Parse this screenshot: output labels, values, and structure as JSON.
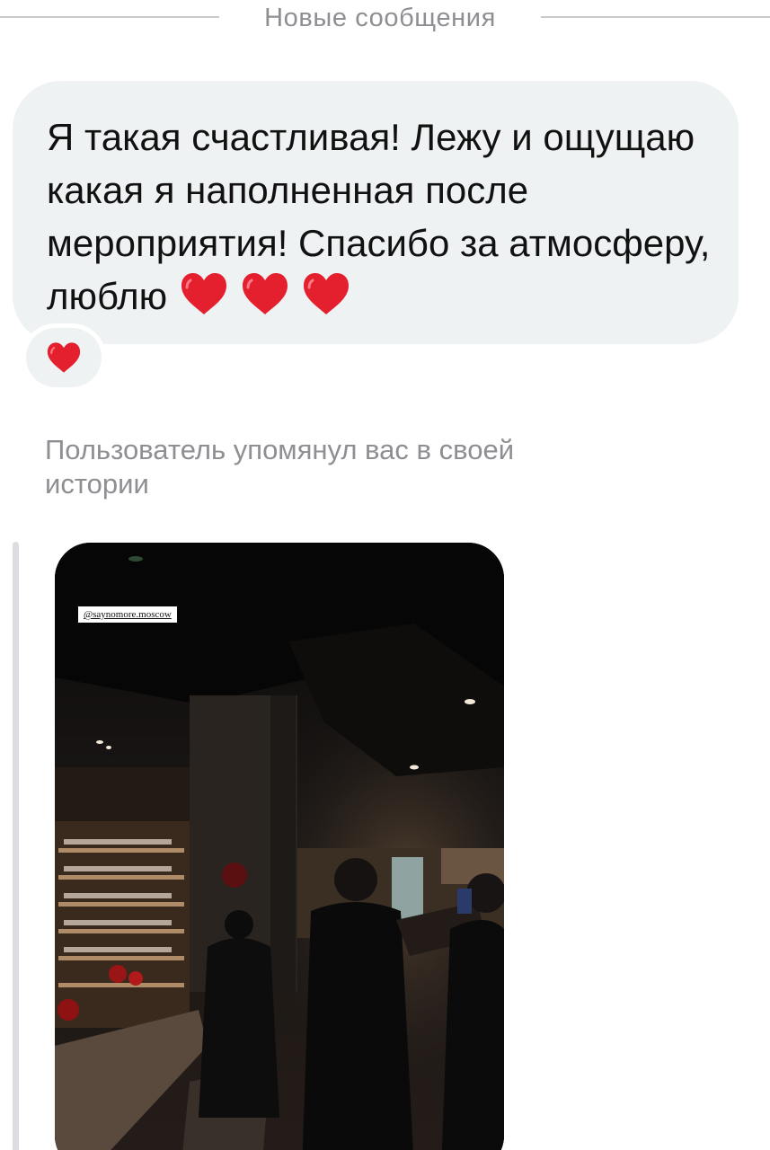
{
  "divider": {
    "label": "Новые сообщения"
  },
  "message": {
    "text": "Я такая счастливая! Лежу и ощущаю какая я наполненная после мероприятия! Спасибо за атмосферу, люблю",
    "emoji": "❤️❤️❤️",
    "reaction": "❤️"
  },
  "mention": {
    "text": "Пользователь упомянул вас в своей истории"
  },
  "story": {
    "tag": "@saynomore.moscow"
  },
  "colors": {
    "bubble": "#eff2f3",
    "heart": "#e41f2e",
    "secondary_text": "#8e8e93",
    "divider": "#c8c9cd"
  }
}
